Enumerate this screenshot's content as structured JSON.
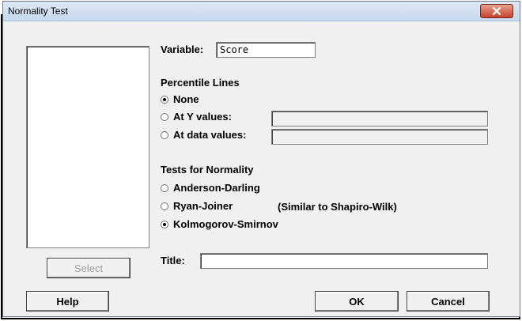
{
  "window": {
    "title": "Normality Test"
  },
  "variable": {
    "label": "Variable:",
    "value": "Score"
  },
  "percentile_lines": {
    "heading": "Percentile Lines",
    "options": [
      {
        "label": "None",
        "checked": true
      },
      {
        "label": "At Y values:",
        "checked": false
      },
      {
        "label": "At data values:",
        "checked": false
      }
    ]
  },
  "tests": {
    "heading": "Tests for Normality",
    "options": [
      {
        "label": "Anderson-Darling",
        "checked": false
      },
      {
        "label": "Ryan-Joiner",
        "checked": false,
        "note": "(Similar to Shapiro-Wilk)"
      },
      {
        "label": "Kolmogorov-Smirnov",
        "checked": true
      }
    ]
  },
  "title_field": {
    "label": "Title:",
    "value": ""
  },
  "buttons": {
    "select": "Select",
    "help": "Help",
    "ok": "OK",
    "cancel": "Cancel"
  },
  "icons": {
    "close": "close-icon"
  },
  "colors": {
    "close_button": "#c7432c",
    "titlebar": "#c6d8ee",
    "dialog_bg": "#f0f0f0"
  }
}
